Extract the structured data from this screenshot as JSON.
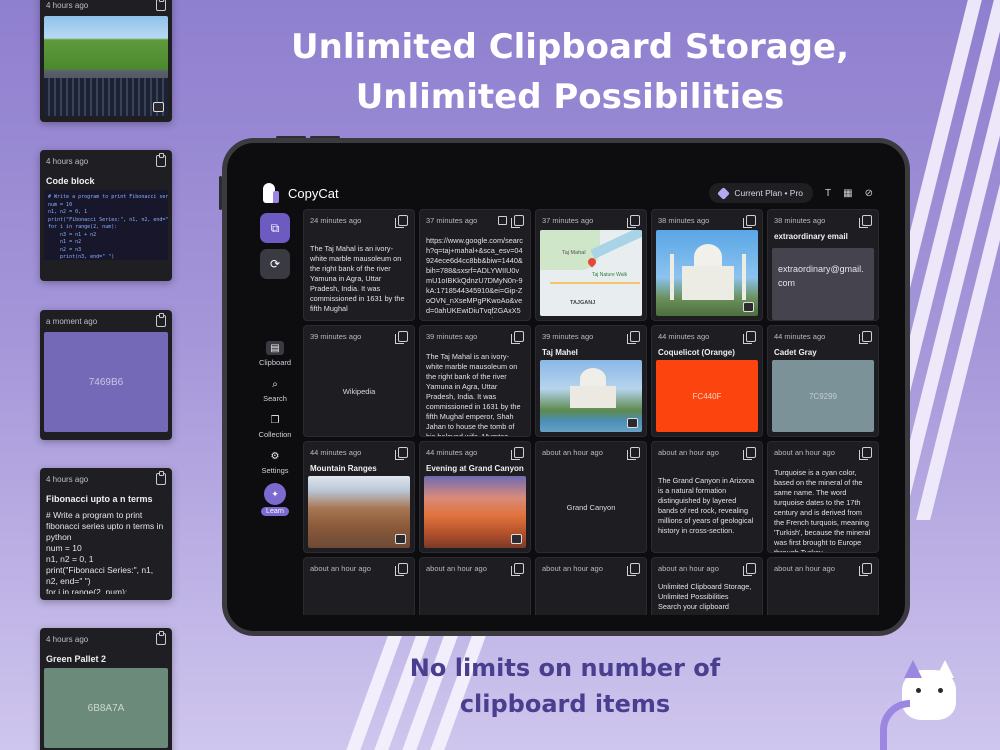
{
  "headline": "Unlimited Clipboard Storage, Unlimited Possibilities",
  "subheadline": "No limits on number of clipboard items",
  "float_cards": [
    {
      "time": "4 hours ago"
    },
    {
      "time": "4 hours ago",
      "title": "Code block",
      "code": "# Write a program to print Fibonacci series\nnum = 10\nn1, n2 = 0, 1\nprint(\"Fibonacci Series:\", n1, n2, end=\" \")\nfor i in range(2, num):\n    n3 = n1 + n2\n    n1 = n2\n    n2 = n3\n    print(n3, end=\" \")\n\nprint()"
    },
    {
      "time": "a moment ago",
      "color_text": "7469B6",
      "color": "#7469B6"
    },
    {
      "time": "4 hours ago",
      "title": "Fibonacci upto a n terms",
      "text": "# Write a program to print fibonacci series upto n terms in python\nnum = 10\nn1, n2 = 0, 1\nprint(\"Fibonacci Series:\", n1, n2, end=\" \")\nfor i in range(2, num):"
    },
    {
      "time": "4 hours ago",
      "title": "Green Pallet 2",
      "color_text": "6B8A7A",
      "color": "#6B8A7A"
    }
  ],
  "app": {
    "name": "CopyCat",
    "plan": "Current Plan • Pro",
    "nav": [
      {
        "label": "Clipboard",
        "icon": "clipboard-icon"
      },
      {
        "label": "Search",
        "icon": "search-icon"
      },
      {
        "label": "Collection",
        "icon": "collection-icon"
      },
      {
        "label": "Settings",
        "icon": "gear-icon"
      }
    ],
    "learn": "Learn"
  },
  "cards": [
    {
      "time": "24 minutes ago",
      "text": "The Taj Mahal is an ivory-white marble mausoleum on the right bank of the river Yamuna in Agra, Uttar Pradesh, India. It was commissioned in 1631 by the fifth Mughal"
    },
    {
      "time": "37 minutes ago",
      "text": "https://www.google.com/search?q=taj+mahal+&sca_esv=04924ece6d4cc8bb&biw=1440&bih=788&sxsrf=ADLYWIIU0vmU1oIBKkQdnzU7DMyN0n-9kA:1718544345910&ei=Gip-ZoOVN_nXseMPgPKwoAo&ved=0ahUKEwiDiuTvqf2GAxX5a2wGHYA5DKQQ4dUDCB"
    },
    {
      "time": "37 minutes ago",
      "map_label1": "Taj Mahal",
      "map_label2": "Taj Nature Walk",
      "map_label3": "TAJGANJ"
    },
    {
      "time": "38 minutes ago"
    },
    {
      "time": "38 minutes ago",
      "title": "extraordinary email",
      "text": "extraordinary@gmail.com"
    },
    {
      "time": "39 minutes ago",
      "center": "Wikipedia"
    },
    {
      "time": "39 minutes ago",
      "text": "The Taj Mahal is an ivory-white marble mausoleum on the right bank of the river Yamuna in Agra, Uttar Pradesh, India. It was commissioned in 1631 by the fifth Mughal emperor, Shah Jahan to house the tomb of his beloved wife, Mumtaz"
    },
    {
      "time": "39 minutes ago",
      "title": "Taj Mahel"
    },
    {
      "time": "44 minutes ago",
      "title": "Coquelicot (Orange)",
      "color_text": "FC440F",
      "color": "#FC440F"
    },
    {
      "time": "44 minutes ago",
      "title": "Cadet Gray",
      "color_text": "7C9299",
      "color": "#7C9299"
    },
    {
      "time": "44 minutes ago",
      "title": "Mountain Ranges"
    },
    {
      "time": "44 minutes ago",
      "title": "Evening at Grand Canyon"
    },
    {
      "time": "about an hour ago",
      "center": "Grand Canyon"
    },
    {
      "time": "about an hour ago",
      "text": "The Grand Canyon in Arizona is a natural formation distinguished by layered bands of red rock, revealing millions of years of geological history in cross-section."
    },
    {
      "time": "about an hour ago",
      "text": "Turquoise is a cyan color, based on the mineral of the same name. The word turquoise dates to the 17th century and is derived from the French turquois, meaning 'Turkish', because the mineral was first brought to Europe through Turkey"
    },
    {
      "time": "about an hour ago"
    },
    {
      "time": "about an hour ago"
    },
    {
      "time": "about an hour ago"
    },
    {
      "time": "about an hour ago",
      "text": "Unlimited Clipboard Storage, Unlimited Possibilities\nSearch your clipboard"
    },
    {
      "time": "about an hour ago"
    }
  ]
}
